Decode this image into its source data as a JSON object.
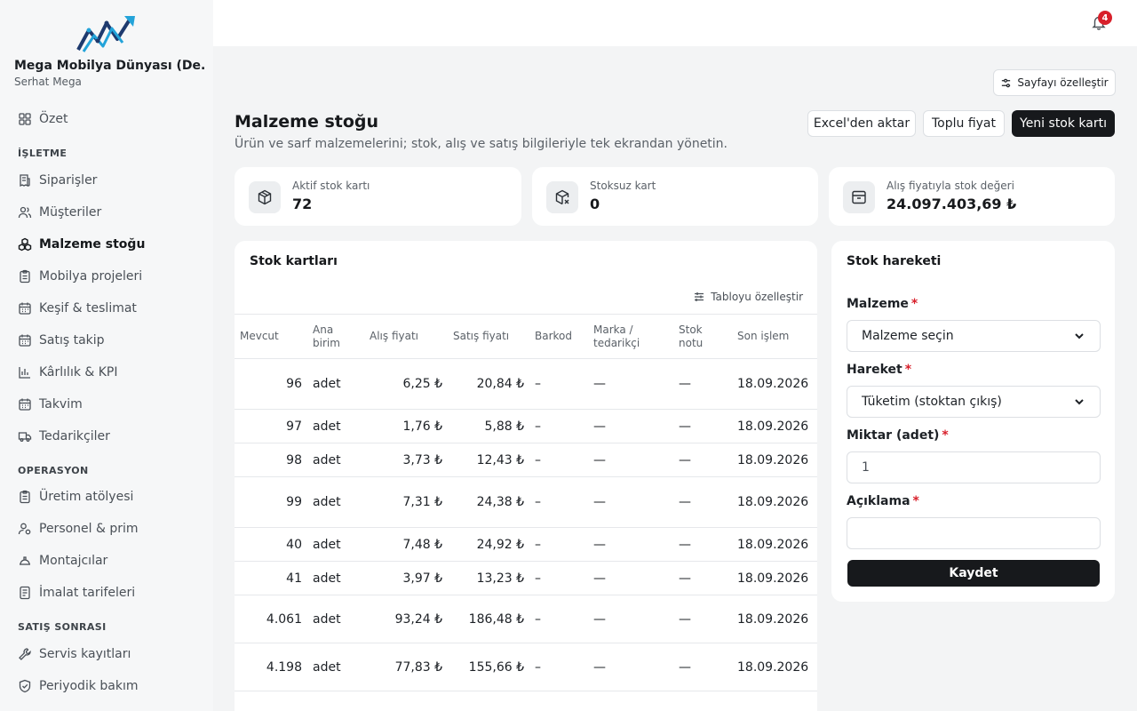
{
  "brand": {
    "name": "Mega Mobilya Dünyası (De...",
    "user": "Serhat Mega"
  },
  "sidebar": {
    "top_items": [
      {
        "label": "Özet",
        "icon": "grid-icon"
      }
    ],
    "sections": [
      {
        "title": "İŞLETME",
        "items": [
          {
            "label": "Siparişler",
            "icon": "receipt-icon"
          },
          {
            "label": "Müşteriler",
            "icon": "users-icon"
          },
          {
            "label": "Malzeme stoğu",
            "icon": "boxes-icon",
            "active": true
          },
          {
            "label": "Mobilya projeleri",
            "icon": "clipboard-icon"
          },
          {
            "label": "Keşif & teslimat",
            "icon": "calendar-icon"
          },
          {
            "label": "Satış takip",
            "icon": "calendar-icon"
          },
          {
            "label": "Kârlılık & KPI",
            "icon": "bar-chart-icon"
          },
          {
            "label": "Takvim",
            "icon": "calendar-icon"
          },
          {
            "label": "Tedarikçiler",
            "icon": "truck-icon"
          }
        ]
      },
      {
        "title": "OPERASYON",
        "items": [
          {
            "label": "Üretim atölyesi",
            "icon": "clipboard-icon"
          },
          {
            "label": "Personel & prim",
            "icon": "user-icon"
          },
          {
            "label": "Montajcılar",
            "icon": "hardhat-icon"
          },
          {
            "label": "İmalat tarifeleri",
            "icon": "list-icon"
          }
        ]
      },
      {
        "title": "SATIŞ SONRASI",
        "items": [
          {
            "label": "Servis kayıtları",
            "icon": "wrench-icon"
          },
          {
            "label": "Periyodik bakım",
            "icon": "shield-icon"
          }
        ]
      }
    ]
  },
  "topbar": {
    "notification_count": "4"
  },
  "page": {
    "customize_label": "Sayfayı özelleştir",
    "title": "Malzeme stoğu",
    "subtitle": "Ürün ve sarf malzemelerini; stok, alış ve satış bilgileriyle tek ekrandan yönetin.",
    "actions": {
      "import": "Excel'den aktar",
      "bulk_price": "Toplu fiyat",
      "new_card": "Yeni stok kartı"
    }
  },
  "stats": [
    {
      "label": "Aktif stok kartı",
      "value": "72",
      "icon": "package-icon"
    },
    {
      "label": "Stoksuz kart",
      "value": "0",
      "icon": "package-x-icon"
    },
    {
      "label": "Alış fiyatıyla stok değeri",
      "value": "24.097.403,69 ₺",
      "icon": "archive-icon"
    }
  ],
  "table": {
    "title": "Stok kartları",
    "customize_label": "Tabloyu özelleştir",
    "columns": [
      "Mevcut",
      "Ana birim",
      "Alış fiyatı",
      "Satış fiyatı",
      "Barkod",
      "Marka / tedarikçi",
      "Stok notu",
      "Son işlem"
    ],
    "rows": [
      [
        "96",
        "adet",
        "6,25 ₺",
        "20,84 ₺",
        "–",
        "—",
        "—",
        "18.09.2026"
      ],
      [
        "97",
        "adet",
        "1,76 ₺",
        "5,88 ₺",
        "–",
        "—",
        "—",
        "18.09.2026"
      ],
      [
        "98",
        "adet",
        "3,73 ₺",
        "12,43 ₺",
        "–",
        "—",
        "—",
        "18.09.2026"
      ],
      [
        "99",
        "adet",
        "7,31 ₺",
        "24,38 ₺",
        "–",
        "—",
        "—",
        "18.09.2026"
      ],
      [
        "40",
        "adet",
        "7,48 ₺",
        "24,92 ₺",
        "–",
        "—",
        "—",
        "18.09.2026"
      ],
      [
        "41",
        "adet",
        "3,97 ₺",
        "13,23 ₺",
        "–",
        "—",
        "—",
        "18.09.2026"
      ],
      [
        "4.061",
        "adet",
        "93,24 ₺",
        "186,48 ₺",
        "–",
        "—",
        "—",
        "18.09.2026"
      ],
      [
        "4.198",
        "adet",
        "77,83 ₺",
        "155,66 ₺",
        "–",
        "—",
        "—",
        "18.09.2026"
      ]
    ]
  },
  "movement": {
    "title": "Stok hareketi",
    "material_label": "Malzeme",
    "material_value": "Malzeme seçin",
    "type_label": "Hareket",
    "type_value": "Tüketim (stoktan çıkış)",
    "qty_label": "Miktar (adet)",
    "qty_value": "1",
    "desc_label": "Açıklama",
    "desc_value": "",
    "required_mark": "*",
    "save_label": "Kaydet"
  }
}
